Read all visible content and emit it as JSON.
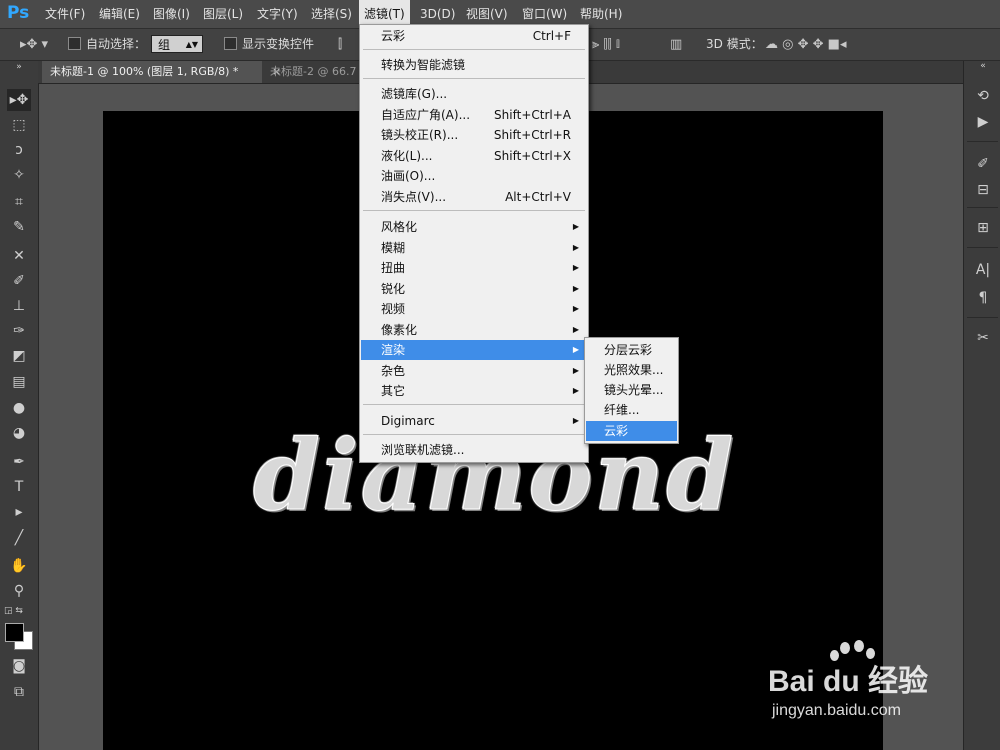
{
  "app": {
    "logo": "Ps"
  },
  "menubar": {
    "items": [
      {
        "label": "文件(F)"
      },
      {
        "label": "编辑(E)"
      },
      {
        "label": "图像(I)"
      },
      {
        "label": "图层(L)"
      },
      {
        "label": "文字(Y)"
      },
      {
        "label": "选择(S)"
      },
      {
        "label": "滤镜(T)"
      },
      {
        "label": "3D(D)"
      },
      {
        "label": "视图(V)"
      },
      {
        "label": "窗口(W)"
      },
      {
        "label": "帮助(H)"
      }
    ]
  },
  "options": {
    "auto_select_label": "自动选择：",
    "auto_select_value": "组",
    "show_transform_label": "显示变换控件",
    "mode_3d_label": "3D 模式："
  },
  "tabs": [
    {
      "label": "未标题-1 @ 100% (图层 1, RGB/8) *"
    },
    {
      "label": "未标题-2 @ 66.7"
    }
  ],
  "canvas": {
    "text": "diamond"
  },
  "filter_menu": {
    "items": [
      {
        "label": "云彩",
        "shortcut": "Ctrl+F"
      },
      {
        "label": "转换为智能滤镜"
      },
      {
        "label": "滤镜库(G)..."
      },
      {
        "label": "自适应广角(A)...",
        "shortcut": "Shift+Ctrl+A"
      },
      {
        "label": "镜头校正(R)...",
        "shortcut": "Shift+Ctrl+R"
      },
      {
        "label": "液化(L)...",
        "shortcut": "Shift+Ctrl+X"
      },
      {
        "label": "油画(O)..."
      },
      {
        "label": "消失点(V)...",
        "shortcut": "Alt+Ctrl+V"
      },
      {
        "label": "风格化"
      },
      {
        "label": "模糊"
      },
      {
        "label": "扭曲"
      },
      {
        "label": "锐化"
      },
      {
        "label": "视频"
      },
      {
        "label": "像素化"
      },
      {
        "label": "渲染"
      },
      {
        "label": "杂色"
      },
      {
        "label": "其它"
      },
      {
        "label": "Digimarc"
      },
      {
        "label": "浏览联机滤镜..."
      }
    ]
  },
  "render_submenu": {
    "items": [
      {
        "label": "分层云彩"
      },
      {
        "label": "光照效果..."
      },
      {
        "label": "镜头光晕..."
      },
      {
        "label": "纤维..."
      },
      {
        "label": "云彩"
      }
    ]
  },
  "watermark": {
    "logo": "Bai du 经验",
    "url": "jingyan.baidu.com"
  },
  "colors": {
    "highlight": "#3f8de8",
    "ps_blue": "#31a8ff",
    "menu_bg": "#f0f0f0"
  }
}
